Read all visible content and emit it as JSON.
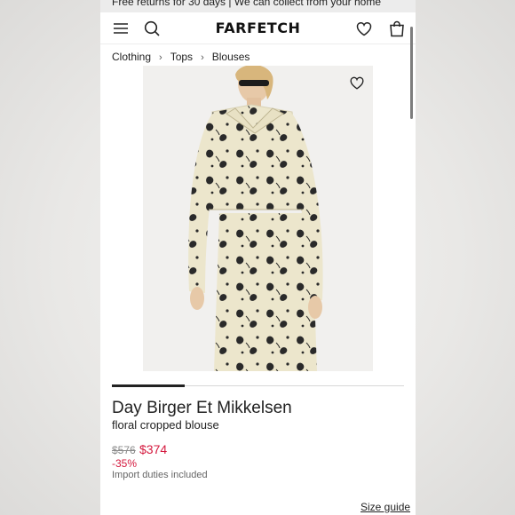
{
  "promo_banner": "Free returns for 30 days | We can collect from your home",
  "header": {
    "logo": "FARFETCH",
    "icons": [
      "menu-icon",
      "search-icon",
      "heart-icon",
      "bag-icon"
    ]
  },
  "breadcrumb": {
    "items": [
      "Clothing",
      "Tops",
      "Blouses"
    ],
    "separator": "›"
  },
  "product": {
    "brand": "Day Birger Et Mikkelsen",
    "description": "floral cropped blouse",
    "original_price": "$576",
    "sale_price": "$374",
    "discount": "-35%",
    "duties_note": "Import duties included",
    "image_index": 1,
    "image_count": 4
  },
  "links": {
    "size_guide": "Size guide"
  },
  "colors": {
    "sale": "#d4183d",
    "text": "#222222",
    "muted": "#8a8a8a"
  }
}
